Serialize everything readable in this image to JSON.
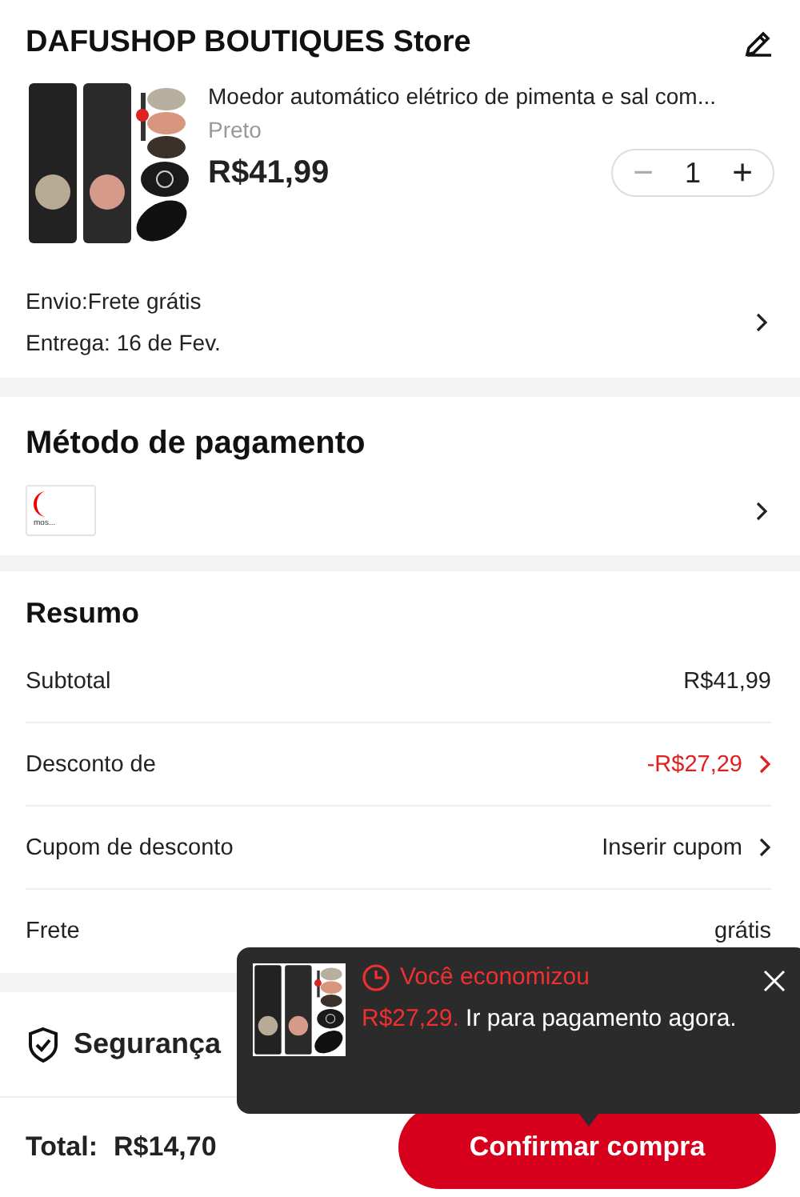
{
  "store": {
    "name": "DAFUSHOP BOUTIQUES Store"
  },
  "product": {
    "title": "Moedor automático elétrico de pimenta e sal com...",
    "variant": "Preto",
    "price": "R$41,99",
    "quantity": "1",
    "decrease": "−",
    "increase": "+"
  },
  "shipping": {
    "method": "Envio:Frete grátis",
    "delivery": "Entrega: 16 de Fev."
  },
  "payment": {
    "title": "Método de pagamento",
    "logo_text": "mos..."
  },
  "summary": {
    "title": "Resumo",
    "rows": [
      {
        "label": "Subtotal",
        "value": "R$41,99",
        "kind": "plain"
      },
      {
        "label": "Desconto de",
        "value": "-R$27,29",
        "kind": "discount"
      },
      {
        "label": "Cupom de desconto",
        "value": "Inserir cupom",
        "kind": "link"
      },
      {
        "label": "Frete",
        "value": "grátis",
        "kind": "plain"
      }
    ]
  },
  "security": {
    "title": "Segurança"
  },
  "footer": {
    "total_label": "Total:",
    "total": "R$14,70",
    "confirm": "Confirmar compra"
  },
  "tip": {
    "headline": "Você economizou",
    "amount": "R$27,29.",
    "message": " Ir para pagamento agora."
  }
}
